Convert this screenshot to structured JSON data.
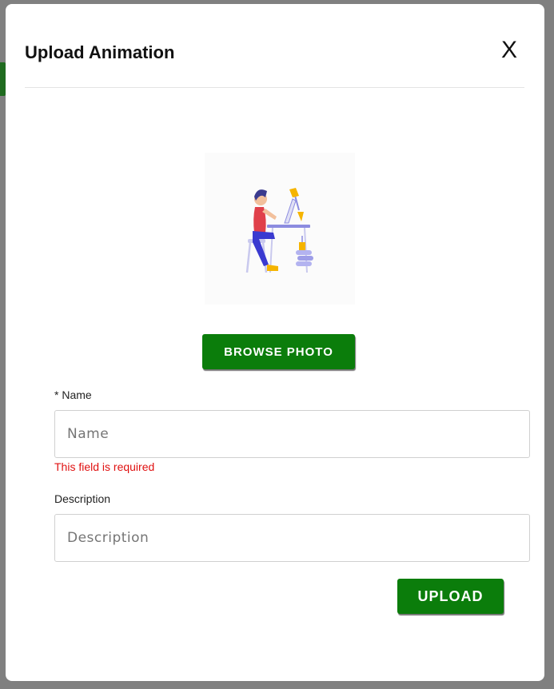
{
  "modal": {
    "title": "Upload Animation",
    "close_label": "X"
  },
  "illustration": {
    "icon": "person-working-at-desk-illustration"
  },
  "buttons": {
    "browse_label": "BROWSE PHOTO",
    "upload_label": "UPLOAD"
  },
  "form": {
    "name": {
      "label": "* Name",
      "placeholder": "Name",
      "value": "",
      "error": "This field is required"
    },
    "description": {
      "label": "Description",
      "placeholder": "Description",
      "value": ""
    }
  },
  "colors": {
    "accent": "#0b7d0b",
    "error": "#e01010",
    "overlay": "#808080"
  }
}
